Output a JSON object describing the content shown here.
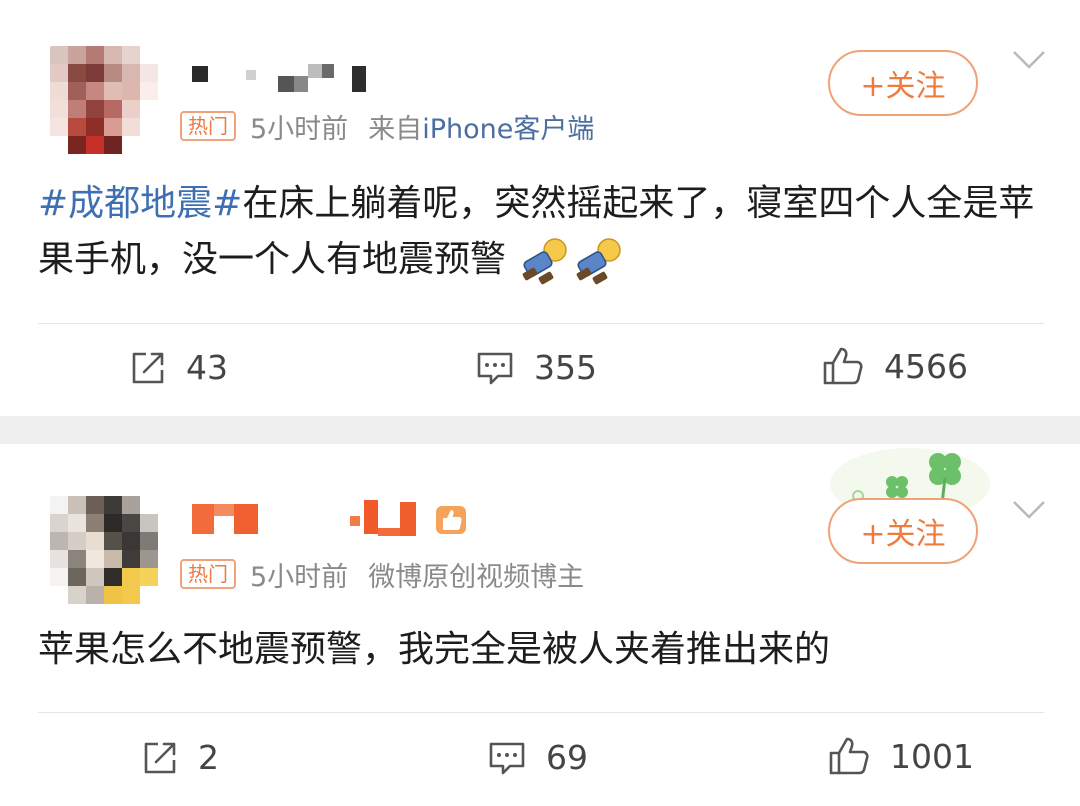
{
  "posts": [
    {
      "badge": "热门",
      "time": "5小时前",
      "source_prefix": "来自",
      "source_link": "iPhone客户端",
      "follow_label": "+关注",
      "topic": "#成都地震#",
      "body": "在床上躺着呢，突然摇起来了，寝室四个人全是苹果手机，没一个人有地震预警",
      "stats": {
        "repost": "43",
        "comment": "355",
        "like": "4566"
      },
      "icons": [
        "repost-icon",
        "comment-icon",
        "like-icon",
        "chevron-down-icon",
        "doge-emoji-icon"
      ]
    },
    {
      "badge": "热门",
      "time": "5小时前",
      "source_text": "微博原创视频博主",
      "follow_label": "+关注",
      "body": "苹果怎么不地震预警，我完全是被人夹着推出来的",
      "stats": {
        "repost": "2",
        "comment": "69",
        "like": "1001"
      },
      "icons": [
        "repost-icon",
        "comment-icon",
        "like-icon",
        "chevron-down-icon",
        "thumbs-up-badge-icon",
        "clover-decoration-icon"
      ]
    }
  ],
  "colors": {
    "accent_orange": "#ef7b3f",
    "topic_blue": "#3f6fb3",
    "source_blue": "#4b6fa0",
    "separator": "#efefef"
  }
}
